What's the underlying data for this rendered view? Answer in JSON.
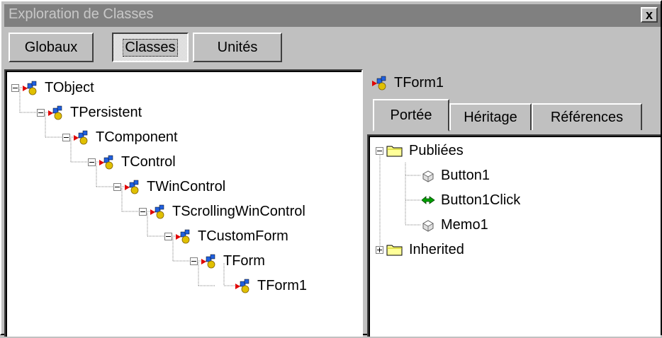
{
  "window": {
    "title": "Exploration de Classes",
    "close_label": "x"
  },
  "tabs": [
    {
      "label": "Globaux",
      "state": "raised"
    },
    {
      "label": "Classes",
      "state": "pressed"
    },
    {
      "label": "Unités",
      "state": "raised"
    }
  ],
  "class_tree": [
    {
      "label": "TObject",
      "depth": 0,
      "expanded": true
    },
    {
      "label": "TPersistent",
      "depth": 1,
      "expanded": true
    },
    {
      "label": "TComponent",
      "depth": 2,
      "expanded": true
    },
    {
      "label": "TControl",
      "depth": 3,
      "expanded": true
    },
    {
      "label": "TWinControl",
      "depth": 4,
      "expanded": true
    },
    {
      "label": "TScrollingWinControl",
      "depth": 5,
      "expanded": true
    },
    {
      "label": "TCustomForm",
      "depth": 6,
      "expanded": true
    },
    {
      "label": "TForm",
      "depth": 7,
      "expanded": true
    },
    {
      "label": "TForm1",
      "depth": 8,
      "expanded": null
    }
  ],
  "detail": {
    "selected_class": "TForm1",
    "subtabs": [
      {
        "label": "Portée",
        "active": true
      },
      {
        "label": "Héritage",
        "active": false
      },
      {
        "label": "Références",
        "active": false
      }
    ],
    "scope_tree": [
      {
        "label": "Publiées",
        "kind": "folder",
        "expander": "minus"
      },
      {
        "label": "Button1",
        "kind": "field"
      },
      {
        "label": "Button1Click",
        "kind": "method"
      },
      {
        "label": "Memo1",
        "kind": "field"
      },
      {
        "label": "Inherited",
        "kind": "folder",
        "expander": "plus"
      }
    ]
  },
  "icons": {
    "class": "class-icon",
    "folder": "folder-icon",
    "field": "field-icon",
    "method": "method-icon",
    "close": "close-icon"
  },
  "colors": {
    "title_bar": "#808080",
    "face": "#c0c0c0",
    "panel": "#ffffff",
    "folder": "#ffff99",
    "method": "#00a000"
  }
}
